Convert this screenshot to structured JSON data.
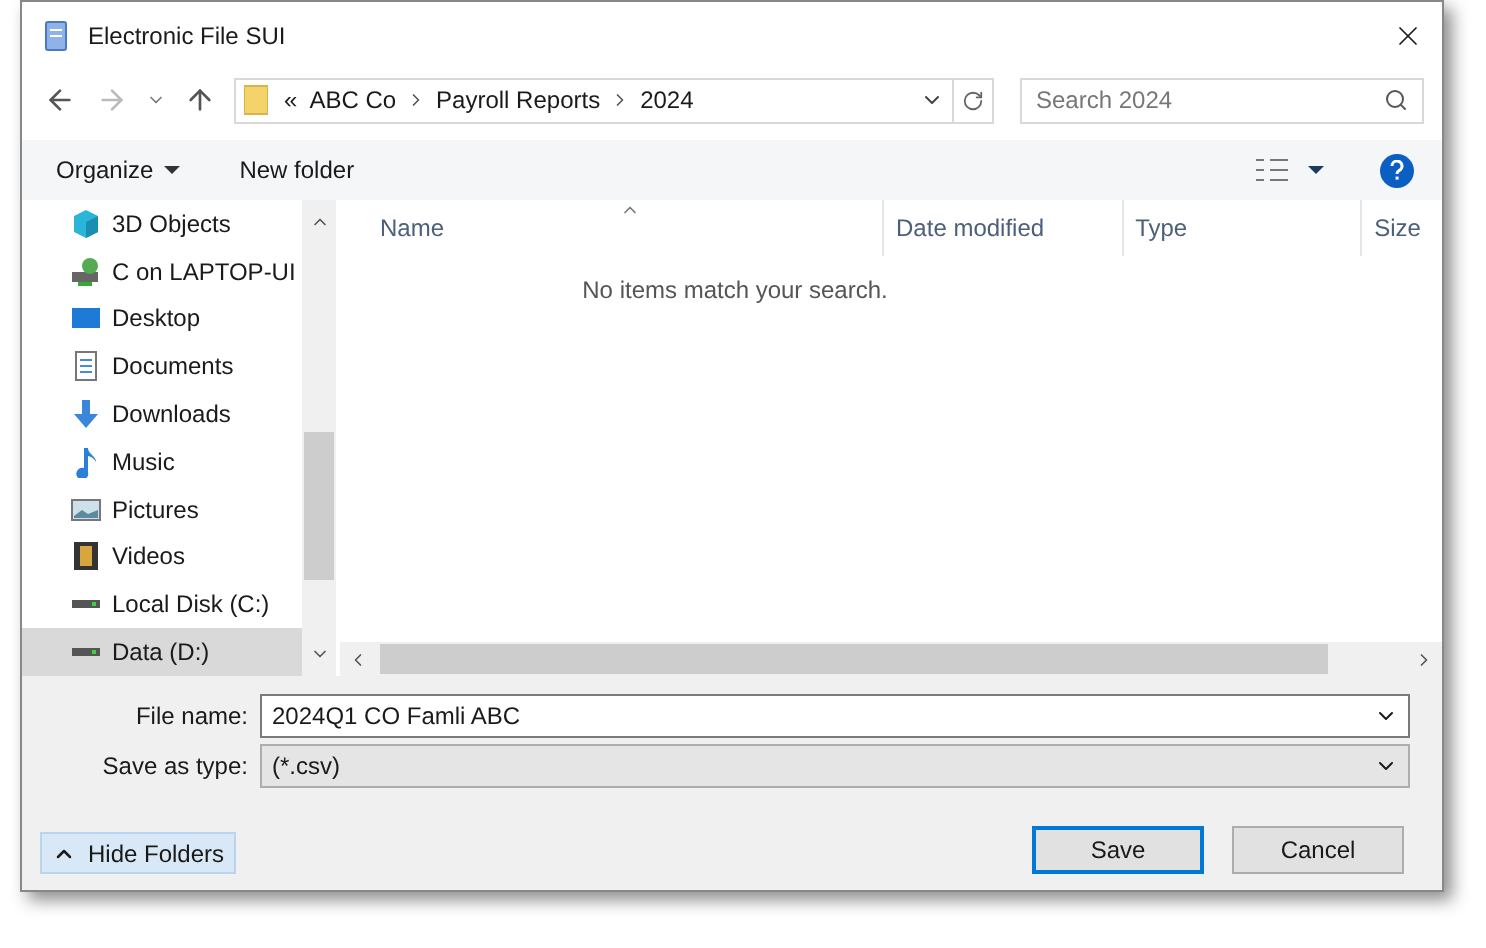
{
  "window": {
    "title": "Electronic File SUI"
  },
  "address": {
    "crumbs": [
      "«",
      "ABC Co",
      "Payroll Reports",
      "2024"
    ]
  },
  "search": {
    "placeholder": "Search 2024"
  },
  "toolbar": {
    "organize": "Organize",
    "new_folder": "New folder"
  },
  "sidebar": {
    "items": [
      {
        "label": "3D Objects",
        "kind": "objects",
        "selected": false
      },
      {
        "label": "C on LAPTOP-UI",
        "kind": "network",
        "selected": false
      },
      {
        "label": "Desktop",
        "kind": "desktop",
        "selected": false
      },
      {
        "label": "Documents",
        "kind": "documents",
        "selected": false
      },
      {
        "label": "Downloads",
        "kind": "downloads",
        "selected": false
      },
      {
        "label": "Music",
        "kind": "music",
        "selected": false
      },
      {
        "label": "Pictures",
        "kind": "pictures",
        "selected": false
      },
      {
        "label": "Videos",
        "kind": "videos",
        "selected": false
      },
      {
        "label": "Local Disk (C:)",
        "kind": "disk",
        "selected": false
      },
      {
        "label": "Data (D:)",
        "kind": "disk",
        "selected": true
      }
    ]
  },
  "table": {
    "columns": [
      "Name",
      "Date modified",
      "Type",
      "Size"
    ],
    "empty_message": "No items match your search."
  },
  "file_name": {
    "label": "File name:",
    "value": "2024Q1 CO Famli ABC"
  },
  "save_as_type": {
    "label": "Save as type:",
    "value": "(*.csv)"
  },
  "hide_folders": "Hide Folders",
  "buttons": [
    "Save",
    "Cancel"
  ]
}
